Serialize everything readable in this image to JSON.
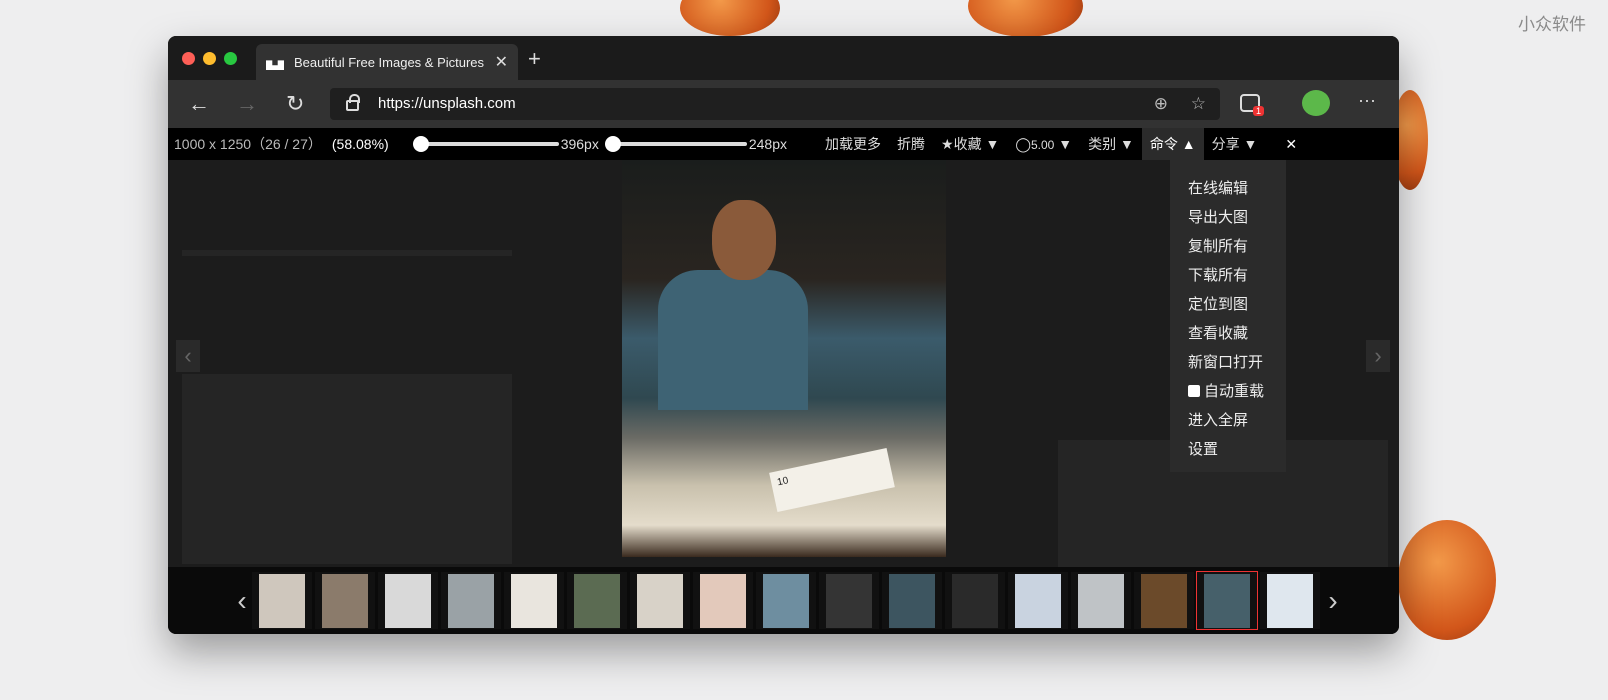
{
  "watermark": "小众软件",
  "tab": {
    "title": "Beautiful Free Images & Pictures",
    "close": "✕",
    "new_tab": "+"
  },
  "address": {
    "url": "https://unsplash.com",
    "badge": "1"
  },
  "toolbar": {
    "dimensions": "1000 x 1250（26 / 27）",
    "zoom": "(58.08%)",
    "slider1_label": "396px",
    "slider1_value": 0,
    "slider2_label": "248px",
    "slider2_value": 0,
    "load_more": "加载更多",
    "toggle": "折腾",
    "favorites": "收藏",
    "rating": "5.00",
    "category": "类别",
    "command": "命令",
    "share": "分享",
    "close": "✕"
  },
  "menu": {
    "items": [
      "在线编辑",
      "导出大图",
      "复制所有",
      "下载所有",
      "定位到图",
      "查看收藏",
      "新窗口打开",
      "自动重载",
      "进入全屏",
      "设置"
    ],
    "auto_reload_checked": false
  },
  "photo": {
    "sign_text": "10"
  },
  "thumbnails": {
    "count": 17,
    "selected_index": 15,
    "colors": [
      "#cfc7bd",
      "#8b7b6b",
      "#d9d9d9",
      "#9aa2a6",
      "#e9e5de",
      "#5b6b52",
      "#d8d2c8",
      "#e3c9bb",
      "#6e8ea0",
      "#343434",
      "#3d5560",
      "#2a2a2a",
      "#c9d3e0",
      "#bfc3c6",
      "#6b4a2a",
      "#46606a",
      "#dfe7ee"
    ]
  }
}
